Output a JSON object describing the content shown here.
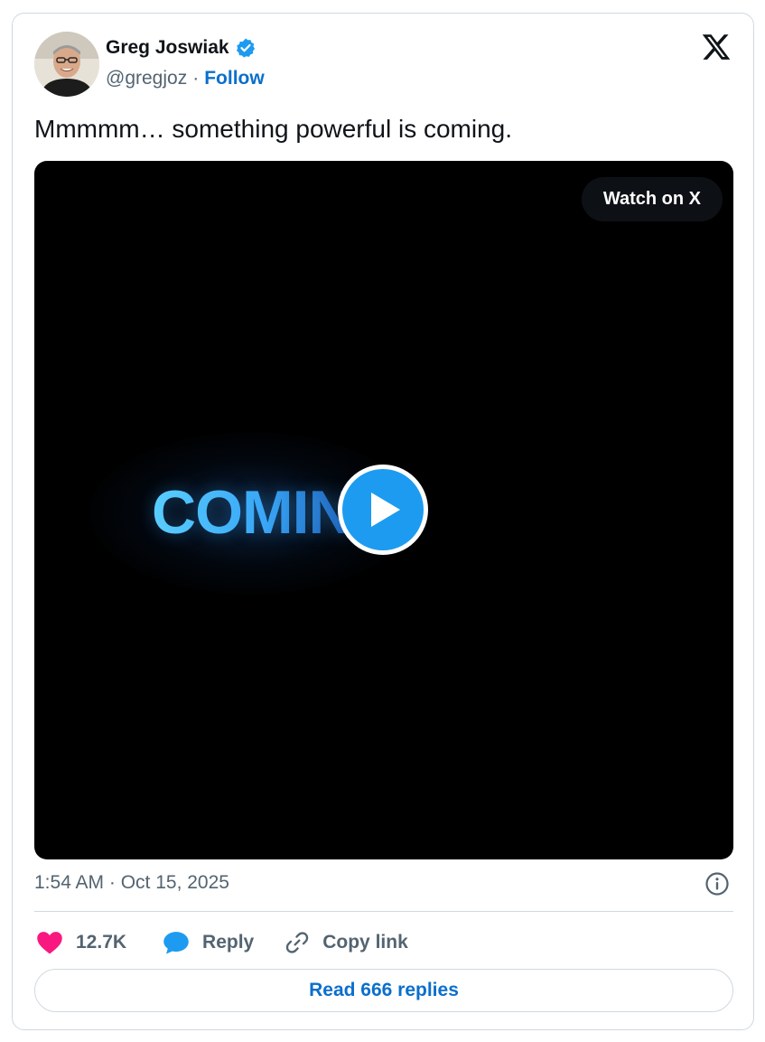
{
  "author": {
    "name": "Greg Joswiak",
    "handle": "@gregjoz",
    "separator": "·",
    "follow_label": "Follow",
    "verified": true,
    "avatar_icon": "profile-photo"
  },
  "platform_logo": "x-logo-icon",
  "tweet": {
    "text": "Mmmmm… something powerful is coming."
  },
  "media": {
    "type": "video",
    "frame_text": "COMING",
    "watch_label": "Watch on X",
    "play_icon": "play-icon"
  },
  "meta": {
    "timestamp": "1:54 AM · Oct 15, 2025",
    "info_icon": "info-icon"
  },
  "actions": {
    "like_count": "12.7K",
    "reply_label": "Reply",
    "copy_link_label": "Copy link"
  },
  "read_replies_label": "Read 666 replies",
  "colors": {
    "accent": "#1d9bf0",
    "link": "#0b6fcc",
    "like": "#f91880",
    "muted": "#536471",
    "border": "#cfd9de"
  }
}
